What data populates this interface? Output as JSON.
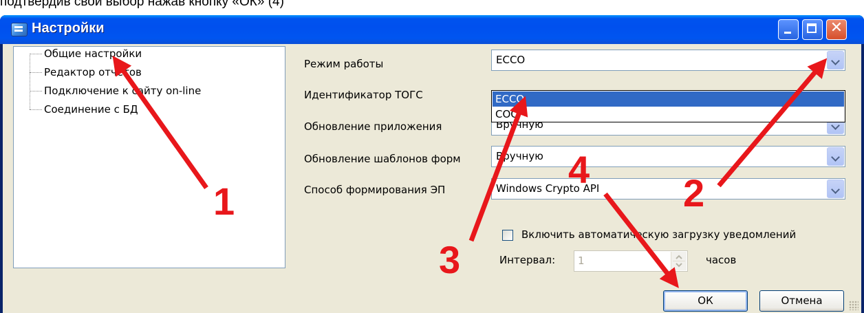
{
  "caption": "подтвердив свой выбор нажав кнопку «ОК» (4)",
  "window": {
    "title": "Настройки",
    "controls": {
      "minimize": "minimize-icon",
      "maximize": "maximize-icon",
      "close_glyph": "✕"
    }
  },
  "tree": {
    "items": [
      "Общие настройки",
      "Редактор отчетов",
      "Подключение к сайту on-line",
      "Соединение с БД"
    ]
  },
  "form": {
    "mode_label": "Режим работы",
    "mode_value": "ЕССО",
    "mode_options": [
      "ЕССО",
      "СОС"
    ],
    "id_label": "Идентификатор ТОГС",
    "app_update_label": "Обновление приложения",
    "app_update_value": "Вручную",
    "templates_update_label": "Обновление шаблонов форм",
    "templates_update_value": "Вручную",
    "signature_label": "Способ формирования ЭП",
    "signature_value": "Windows Crypto API",
    "auto_load_label": "Включить автоматическую загрузку уведомлений",
    "auto_load_checked": false,
    "interval_label": "Интервал:",
    "interval_value": "1",
    "interval_unit": "часов"
  },
  "buttons": {
    "ok": "ОК",
    "cancel": "Отмена"
  },
  "annotations": {
    "color": "#e8171b",
    "labels": [
      "1",
      "2",
      "3",
      "4"
    ]
  }
}
